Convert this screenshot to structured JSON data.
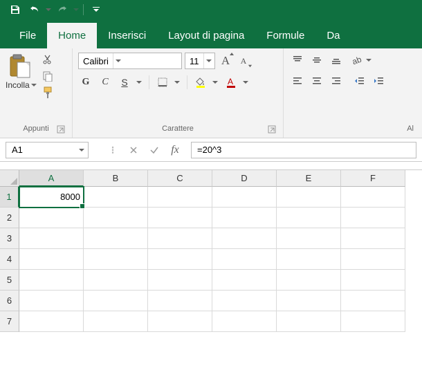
{
  "titlebar": {
    "save_icon": "save",
    "undo_icon": "undo",
    "redo_icon": "redo"
  },
  "tabs": {
    "file": "File",
    "home": "Home",
    "insert": "Inserisci",
    "layout": "Layout di pagina",
    "formulas": "Formule",
    "data": "Da"
  },
  "ribbon": {
    "clipboard": {
      "paste": "Incolla",
      "group": "Appunti"
    },
    "font": {
      "name": "Calibri",
      "size": "11",
      "bold": "G",
      "italic": "C",
      "underline": "S",
      "group": "Carattere"
    },
    "alignment": {
      "group": "Al"
    }
  },
  "formula_bar": {
    "name_box": "A1",
    "formula": "=20^3",
    "fx": "fx"
  },
  "grid": {
    "columns": [
      "A",
      "B",
      "C",
      "D",
      "E",
      "F"
    ],
    "rows": [
      "1",
      "2",
      "3",
      "4",
      "5",
      "6",
      "7"
    ],
    "active_cell": {
      "row": 0,
      "col": 0,
      "value": "8000"
    }
  }
}
